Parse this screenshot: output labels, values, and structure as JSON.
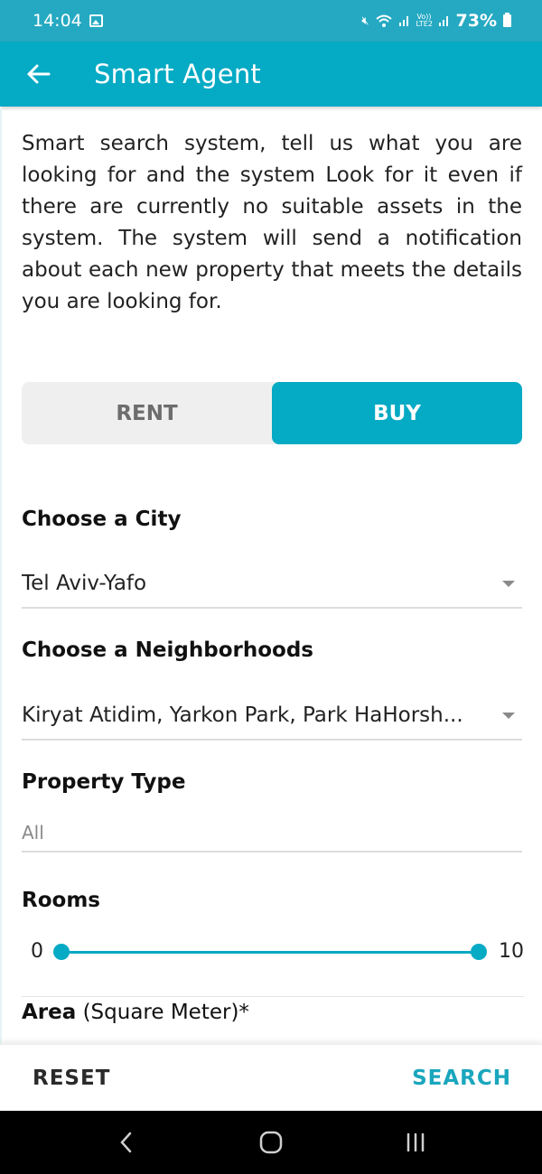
{
  "status_bar": {
    "time": "14:04",
    "notification_icon": "gallery-icon",
    "icons": [
      "mute-icon",
      "wifi-icon",
      "signal-icon",
      "volte-lte2-icon",
      "signal-icon"
    ],
    "volte_text": "Vo)) LTE2",
    "battery": "73%"
  },
  "app_bar": {
    "back_icon": "arrow-left-icon",
    "title": "Smart Agent"
  },
  "description": "Smart search system, tell us what you are looking for and the system Look for it even if there are currently no suitable assets in the system. The system will send a notification about each new property that meets the details you are looking for.",
  "deal_type": {
    "options": [
      {
        "label": "RENT",
        "selected": false
      },
      {
        "label": "BUY",
        "selected": true
      }
    ]
  },
  "form": {
    "city": {
      "label": "Choose a City",
      "value": "Tel Aviv-Yafo"
    },
    "neighborhoods": {
      "label": "Choose a Neighborhoods",
      "value": "Kiryat Atidim, Yarkon Park, Park HaHorsh..."
    },
    "property_type": {
      "label": "Property Type",
      "placeholder": "All"
    },
    "rooms": {
      "label": "Rooms",
      "min_label": "0",
      "max_label": "10",
      "range_min": 0,
      "range_max": 10,
      "selected_min": 0,
      "selected_max": 10
    },
    "area": {
      "label_bold": "Area",
      "label_rest": " (Square Meter)*"
    }
  },
  "actions": {
    "reset_label": "RESET",
    "search_label": "SEARCH"
  },
  "nav_bar": {
    "buttons": [
      "back-icon",
      "home-icon",
      "recents-icon"
    ]
  },
  "colors": {
    "primary": "#05aac4",
    "status_bar": "#25a9c2",
    "search_text": "#1aa6bd"
  }
}
